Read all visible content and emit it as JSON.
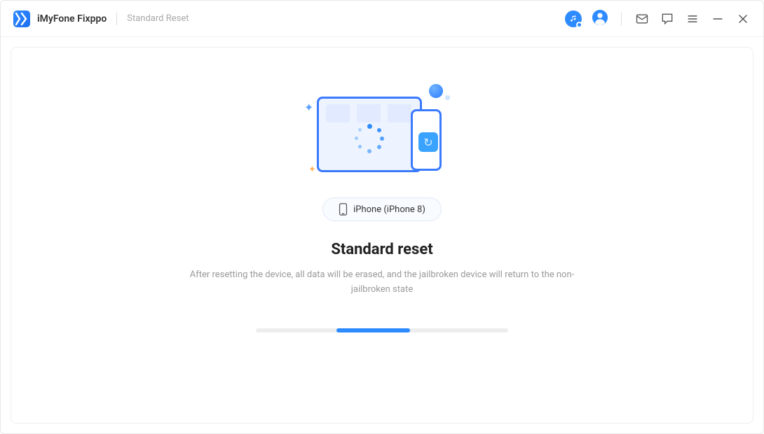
{
  "titlebar": {
    "app_name": "iMyFone Fixppo",
    "breadcrumb": "Standard Reset"
  },
  "main": {
    "device_label": "iPhone (iPhone 8)",
    "heading": "Standard reset",
    "description": "After resetting the device, all data will be erased, and the jailbroken device will return to the non-jailbroken state"
  }
}
